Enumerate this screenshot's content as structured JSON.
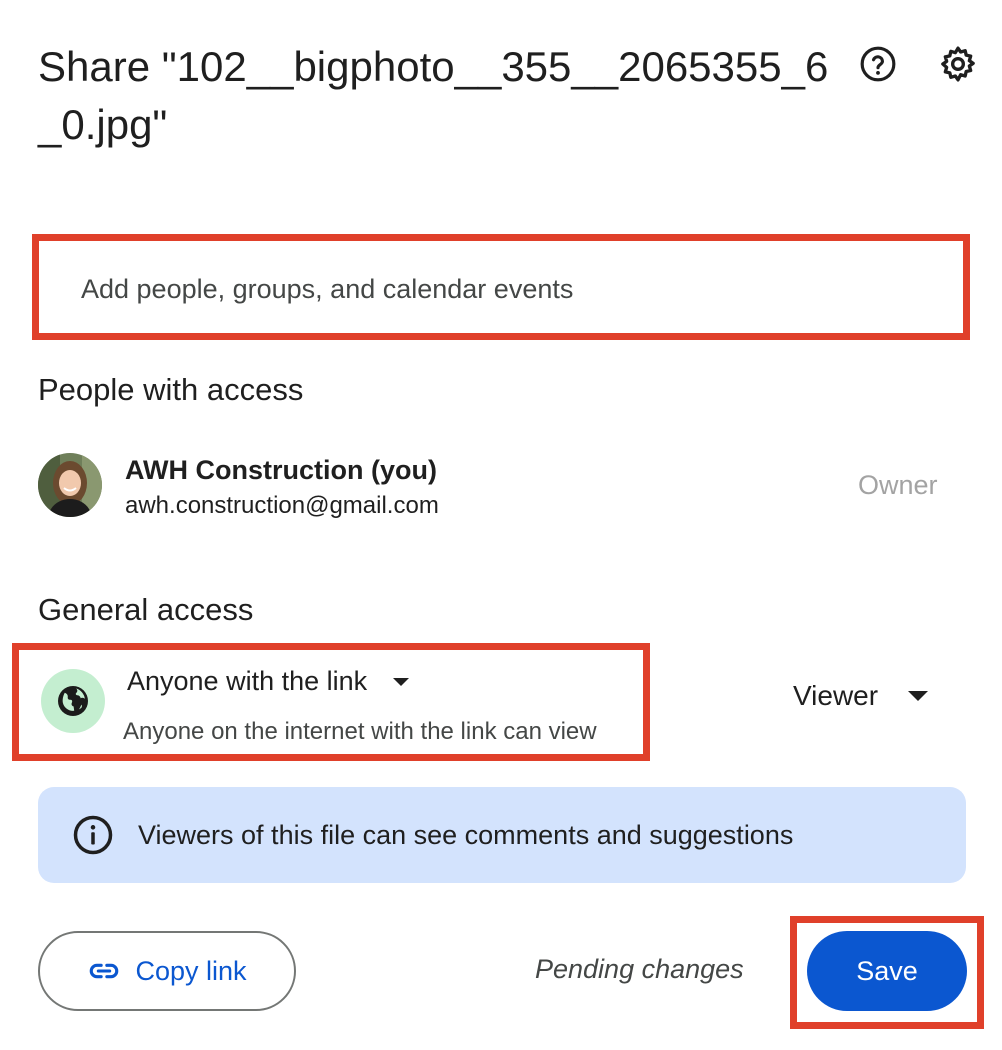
{
  "dialog": {
    "title": "Share \"102__bigphoto__355__2065355_6_0.jpg\""
  },
  "header": {
    "help_icon": "help-circle-icon",
    "settings_icon": "gear-icon"
  },
  "search": {
    "placeholder": "Add people, groups, and calendar events",
    "value": ""
  },
  "people_section": {
    "title": "People with access",
    "people": [
      {
        "name": "AWH Construction (you)",
        "email": "awh.construction@gmail.com",
        "role": "Owner"
      }
    ]
  },
  "general_access": {
    "title": "General access",
    "icon": "globe-icon",
    "selected": "Anyone with the link",
    "description": "Anyone on the internet with the link can view",
    "role": "Viewer"
  },
  "info_banner": {
    "icon": "info-icon",
    "text": "Viewers of this file can see comments and suggestions"
  },
  "footer": {
    "copy_link_label": "Copy link",
    "copy_link_icon": "link-icon",
    "pending_text": "Pending changes",
    "save_label": "Save"
  },
  "colors": {
    "accent": "#0b57d0",
    "info_background": "#d3e3fd",
    "globe_background": "#c4eed0",
    "annotation_red": "#e0402a"
  }
}
